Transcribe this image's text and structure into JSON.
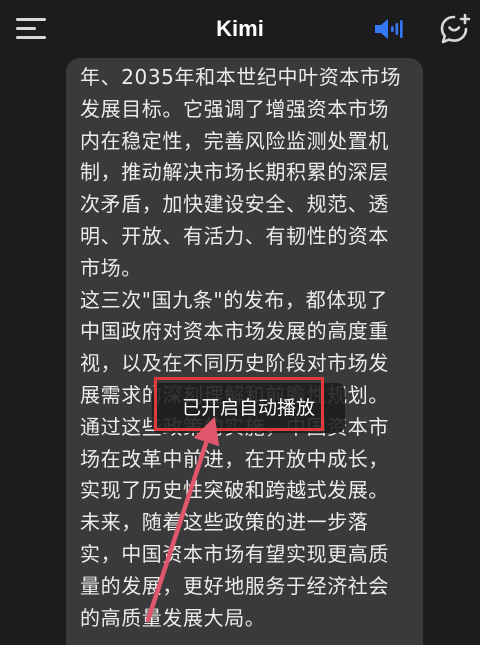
{
  "header": {
    "title": "Kimi",
    "menu_icon": "hamburger-menu-icon",
    "speaker_icon": "speaker-icon",
    "new_chat_icon": "new-chat-icon",
    "accent_color": "#3478f6"
  },
  "message": {
    "lines": [
      "年、2035年和本世纪中叶资本市场",
      "发展目标。它强调了增强资本市场",
      "内在稳定性，完善风险监测处置机",
      "制，推动解决市场长期积累的深层",
      "次矛盾，加快建设安全、规范、透",
      "明、开放、有活力、有韧性的资本",
      "市场。",
      "这三次\"国九条\"的发布，都体现了",
      "中国政府对资本市场发展的高度重",
      "视，以及在不同历史阶段对市场发",
      "展需求的深刻理解和前瞻性规划。",
      "通过这些政策的实施，中国资本市",
      "场在改革中前进，在开放中成长，",
      "实现了历史性突破和跨越式发展。",
      "未来，随着这些政策的进一步落",
      "实，中国资本市场有望实现更高质",
      "量的发展，更好地服务于经济社会",
      "的高质量发展大局。"
    ]
  },
  "toast": {
    "text": "已开启自动播放"
  },
  "annotation": {
    "highlight_color": "#e03a3a"
  }
}
